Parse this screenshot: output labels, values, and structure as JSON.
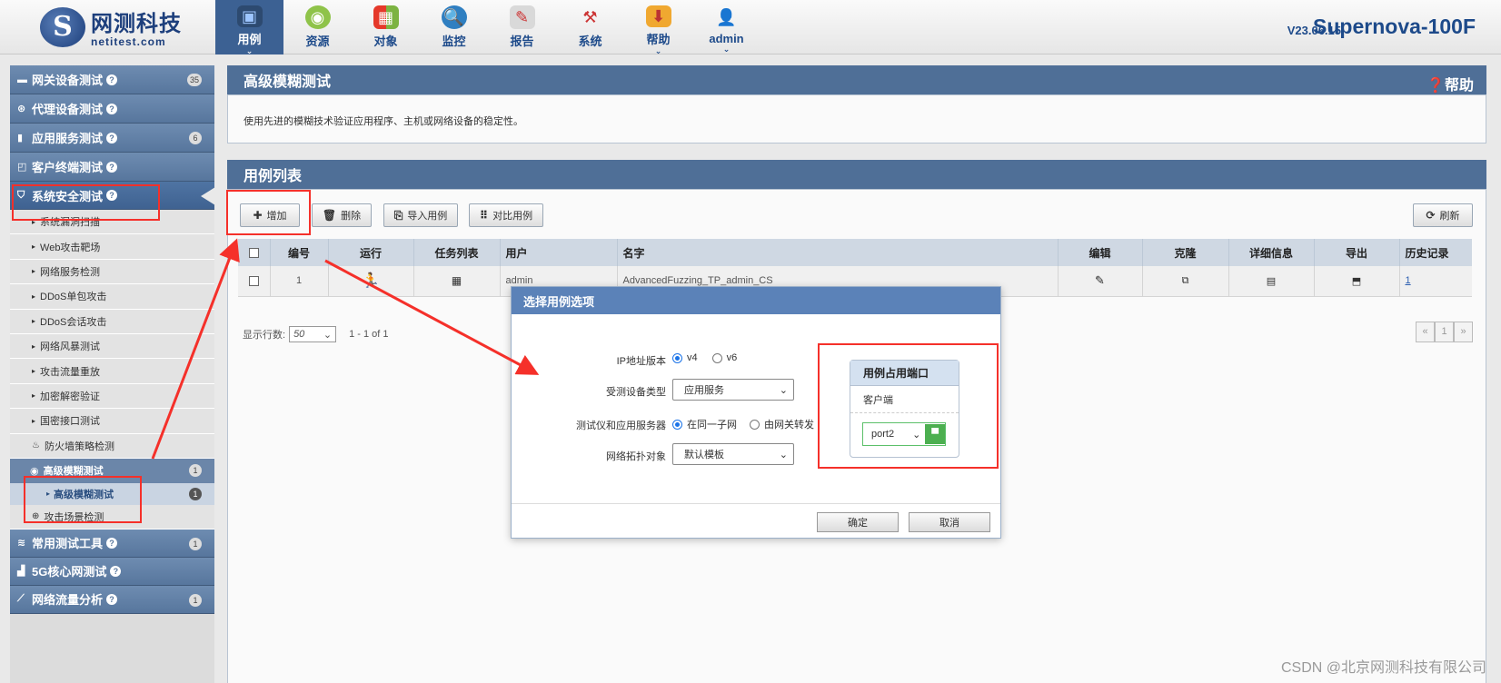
{
  "brand": {
    "name_cn": "网测科技",
    "name_en": "netitest.com"
  },
  "nav": [
    {
      "label": "用例",
      "icon": "monitor-icon",
      "active": true,
      "caret": true
    },
    {
      "label": "资源",
      "icon": "coins-icon"
    },
    {
      "label": "对象",
      "icon": "windows-icon"
    },
    {
      "label": "监控",
      "icon": "globe-search-icon"
    },
    {
      "label": "报告",
      "icon": "report-icon"
    },
    {
      "label": "系统",
      "icon": "tools-icon"
    },
    {
      "label": "帮助",
      "icon": "download-folder-icon",
      "caret": true
    },
    {
      "label": "admin",
      "icon": "user-icon",
      "caret": true
    }
  ],
  "version": "V23.06.15",
  "product": "Supernova-100F",
  "sidebar": {
    "sections": [
      {
        "label": "网关设备测试",
        "icon": "server-icon",
        "badge": "35"
      },
      {
        "label": "代理设备测试",
        "icon": "proxy-icon"
      },
      {
        "label": "应用服务测试",
        "icon": "app-server-icon",
        "badge": "6"
      },
      {
        "label": "客户终端测试",
        "icon": "terminal-icon"
      },
      {
        "label": "系统安全测试",
        "icon": "shield-icon",
        "active": true
      }
    ],
    "security_items": [
      "系统漏洞扫描",
      "Web攻击靶场",
      "网络服务检测",
      "DDoS单包攻击",
      "DDoS会话攻击",
      "网络风暴测试",
      "攻击流量重放",
      "加密解密验证",
      "国密接口测试"
    ],
    "firewall_item": "防火墙策略检测",
    "fuzzing_group": {
      "label": "高级模糊测试",
      "badge": "1"
    },
    "fuzzing_sub": {
      "label": "高级模糊测试",
      "badge": "1"
    },
    "attack_scene": "攻击场景检测",
    "bottom_sections": [
      {
        "label": "常用测试工具",
        "icon": "wifi-icon",
        "badge": "1"
      },
      {
        "label": "5G核心网测试",
        "icon": "signal-bars-icon"
      },
      {
        "label": "网络流量分析",
        "icon": "line-chart-icon",
        "badge": "1"
      }
    ]
  },
  "intro_panel": {
    "title": "高级模糊测试",
    "help": "❓帮助",
    "description": "使用先进的模糊技术验证应用程序、主机或网络设备的稳定性。"
  },
  "list_panel": {
    "title": "用例列表",
    "buttons": {
      "add": "增加",
      "delete": "删除",
      "import": "导入用例",
      "compare": "对比用例",
      "refresh": "刷新"
    },
    "columns": [
      "编号",
      "运行",
      "任务列表",
      "用户",
      "名字",
      "编辑",
      "克隆",
      "详细信息",
      "导出",
      "历史记录"
    ],
    "rows": [
      {
        "id": "1",
        "user": "admin",
        "name": "AdvancedFuzzing_TP_admin_CS",
        "history": "1"
      }
    ],
    "rows_label": "显示行数:",
    "rows_per_page": "50",
    "range": "1 - 1 of 1",
    "page": "1"
  },
  "modal": {
    "title": "选择用例选项",
    "ip_label": "IP地址版本",
    "ip_options": [
      "v4",
      "v6"
    ],
    "dut_label": "受测设备类型",
    "dut_value": "应用服务",
    "tester_label": "测试仪和应用服务器",
    "tester_options": [
      "在同一子网",
      "由网关转发"
    ],
    "topo_label": "网络拓扑对象",
    "topo_value": "默认模板",
    "port_card": {
      "title": "用例占用端口",
      "role": "客户端",
      "port": "port2"
    },
    "ok": "确定",
    "cancel": "取消"
  },
  "annotation_color": "#f5302a",
  "watermark": "CSDN @北京网测科技有限公司"
}
